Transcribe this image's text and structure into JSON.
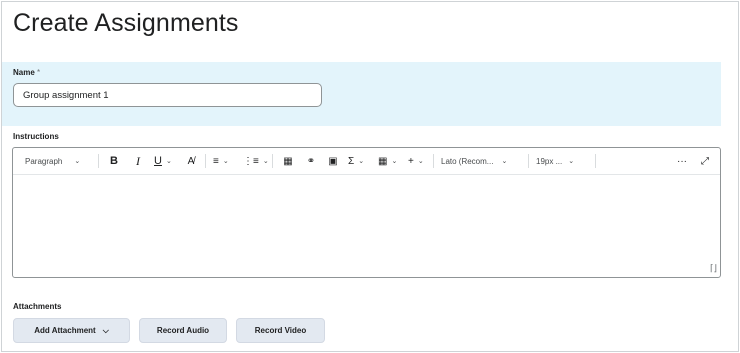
{
  "page": {
    "title": "Create Assignments"
  },
  "name_field": {
    "label": "Name",
    "required_marker": "*",
    "value": "Group assignment 1"
  },
  "instructions": {
    "label": "Instructions",
    "toolbar": {
      "paragraph": "Paragraph",
      "bold": "B",
      "italic": "I",
      "underline": "U",
      "font": "Lato (Recom...",
      "size": "19px ...",
      "more": "···"
    }
  },
  "attachments": {
    "label": "Attachments",
    "add_attachment": "Add Attachment",
    "record_audio": "Record Audio",
    "record_video": "Record Video"
  },
  "colors": {
    "name_section_bg": "#e3f4fb",
    "button_bg": "#e3e9f1",
    "text": "#202122"
  }
}
